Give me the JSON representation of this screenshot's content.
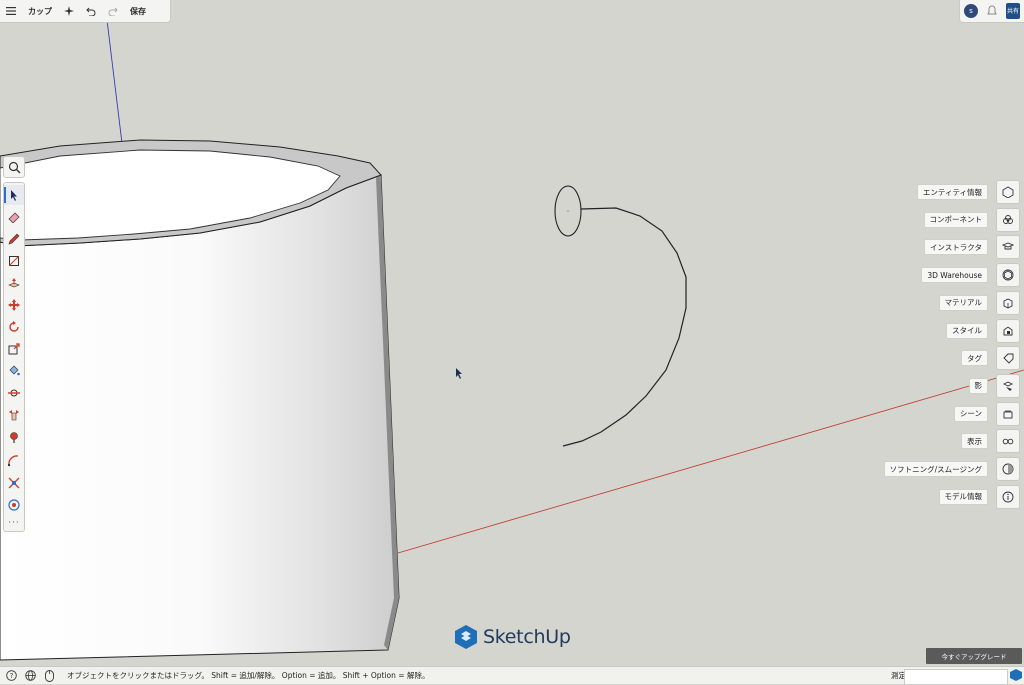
{
  "toolbar": {
    "menu_icon": "hamburger-icon",
    "model_name": "カップ",
    "save_label": "保存"
  },
  "topright": {
    "avatar_initial": "s",
    "share_label": "共有"
  },
  "right_panels": [
    {
      "label": "エンティティ情報",
      "icon": "entity-info-icon"
    },
    {
      "label": "コンポーネント",
      "icon": "components-icon"
    },
    {
      "label": "インストラクタ",
      "icon": "instructor-icon"
    },
    {
      "label": "3D Warehouse",
      "icon": "warehouse-icon"
    },
    {
      "label": "マテリアル",
      "icon": "materials-icon"
    },
    {
      "label": "スタイル",
      "icon": "styles-icon"
    },
    {
      "label": "タグ",
      "icon": "tags-icon"
    },
    {
      "label": "影",
      "icon": "shadows-icon"
    },
    {
      "label": "シーン",
      "icon": "scenes-icon"
    },
    {
      "label": "表示",
      "icon": "display-icon"
    },
    {
      "label": "ソフトニング/スムージング",
      "icon": "soften-icon"
    },
    {
      "label": "モデル情報",
      "icon": "model-info-icon"
    }
  ],
  "logo": {
    "text": "SketchUp"
  },
  "upgrade_label": "今すぐアップグレード",
  "statusbar": {
    "message": "オブジェクトをクリックまたはドラッグ。 Shift = 追加/解除。 Option = 追加。 Shift + Option = 解除。",
    "measure_label": "測定",
    "measure_value": ""
  },
  "colors": {
    "background": "#d5d5d0",
    "panel": "#f4f4f2",
    "accent_blue": "#2a6fd0",
    "tool_red": "#d23a2a",
    "axis_red": "#c0392b",
    "axis_blue": "#3a3ab0",
    "logo": "#223a5c"
  }
}
